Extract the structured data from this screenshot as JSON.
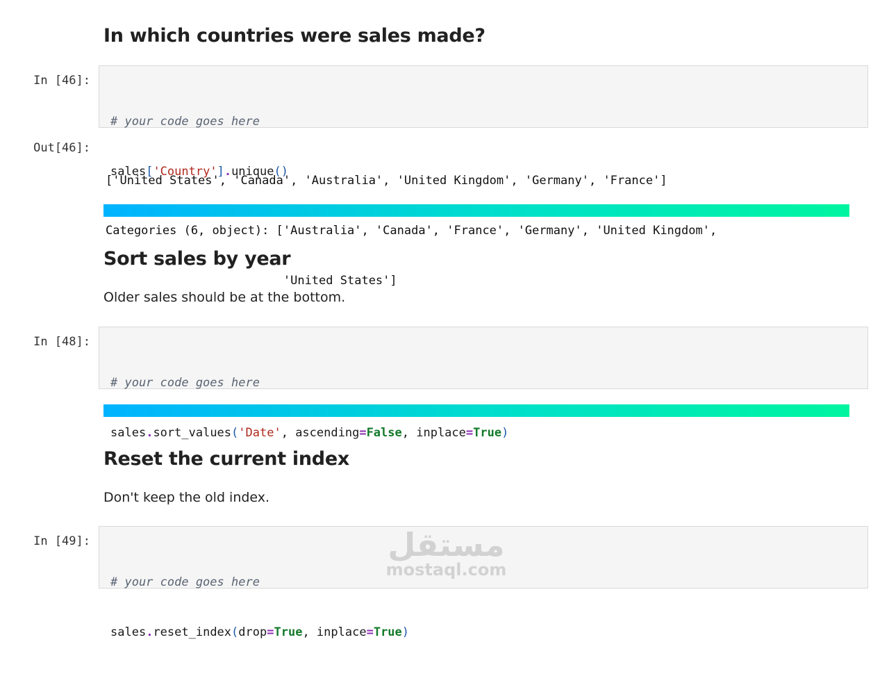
{
  "section1": {
    "title": "In which countries were sales made?",
    "cell": {
      "prompt": "In [46]:",
      "comment": "# your code goes here",
      "code": {
        "var": "sales",
        "open": "[",
        "arg": "'Country'",
        "close": "]",
        "dot": ".",
        "method": "unique",
        "parens": "()"
      }
    },
    "output": {
      "prompt": "Out[46]:",
      "lines": [
        "['United States', 'Canada', 'Australia', 'United Kingdom', 'Germany', 'France']",
        "Categories (6, object): ['Australia', 'Canada', 'France', 'Germany', 'United Kingdom',",
        "                         'United States']"
      ]
    }
  },
  "section2": {
    "title": "Sort sales by year",
    "description": "Older sales should be at the bottom.",
    "cell": {
      "prompt": "In [48]:",
      "comment": "# your code goes here",
      "code": {
        "var": "sales",
        "dot": ".",
        "method": "sort_values",
        "open": "(",
        "arg1": "'Date'",
        "sep1": ", ",
        "kw1": "ascending",
        "eq1": "=",
        "val1": "False",
        "sep2": ", ",
        "kw2": "inplace",
        "eq2": "=",
        "val2": "True",
        "close": ")"
      }
    }
  },
  "section3": {
    "title": "Reset the current index",
    "description": "Don't keep the old index.",
    "cell": {
      "prompt": "In [49]:",
      "comment": "# your code goes here",
      "code": {
        "var": "sales",
        "dot": ".",
        "method": "reset_index",
        "open": "(",
        "kw1": "drop",
        "eq1": "=",
        "val1": "True",
        "sep1": ", ",
        "kw2": "inplace",
        "eq2": "=",
        "val2": "True",
        "close": ")"
      }
    }
  },
  "watermark": {
    "arabic": "مستقل",
    "latin": "mostaql.com"
  },
  "colors": {
    "divider_start": "#00b3ff",
    "divider_end": "#00f5a0",
    "cell_bg": "#f5f5f5",
    "string": "#b02a1f",
    "keyword": "#137a2a",
    "operator": "#8a2bb0"
  }
}
